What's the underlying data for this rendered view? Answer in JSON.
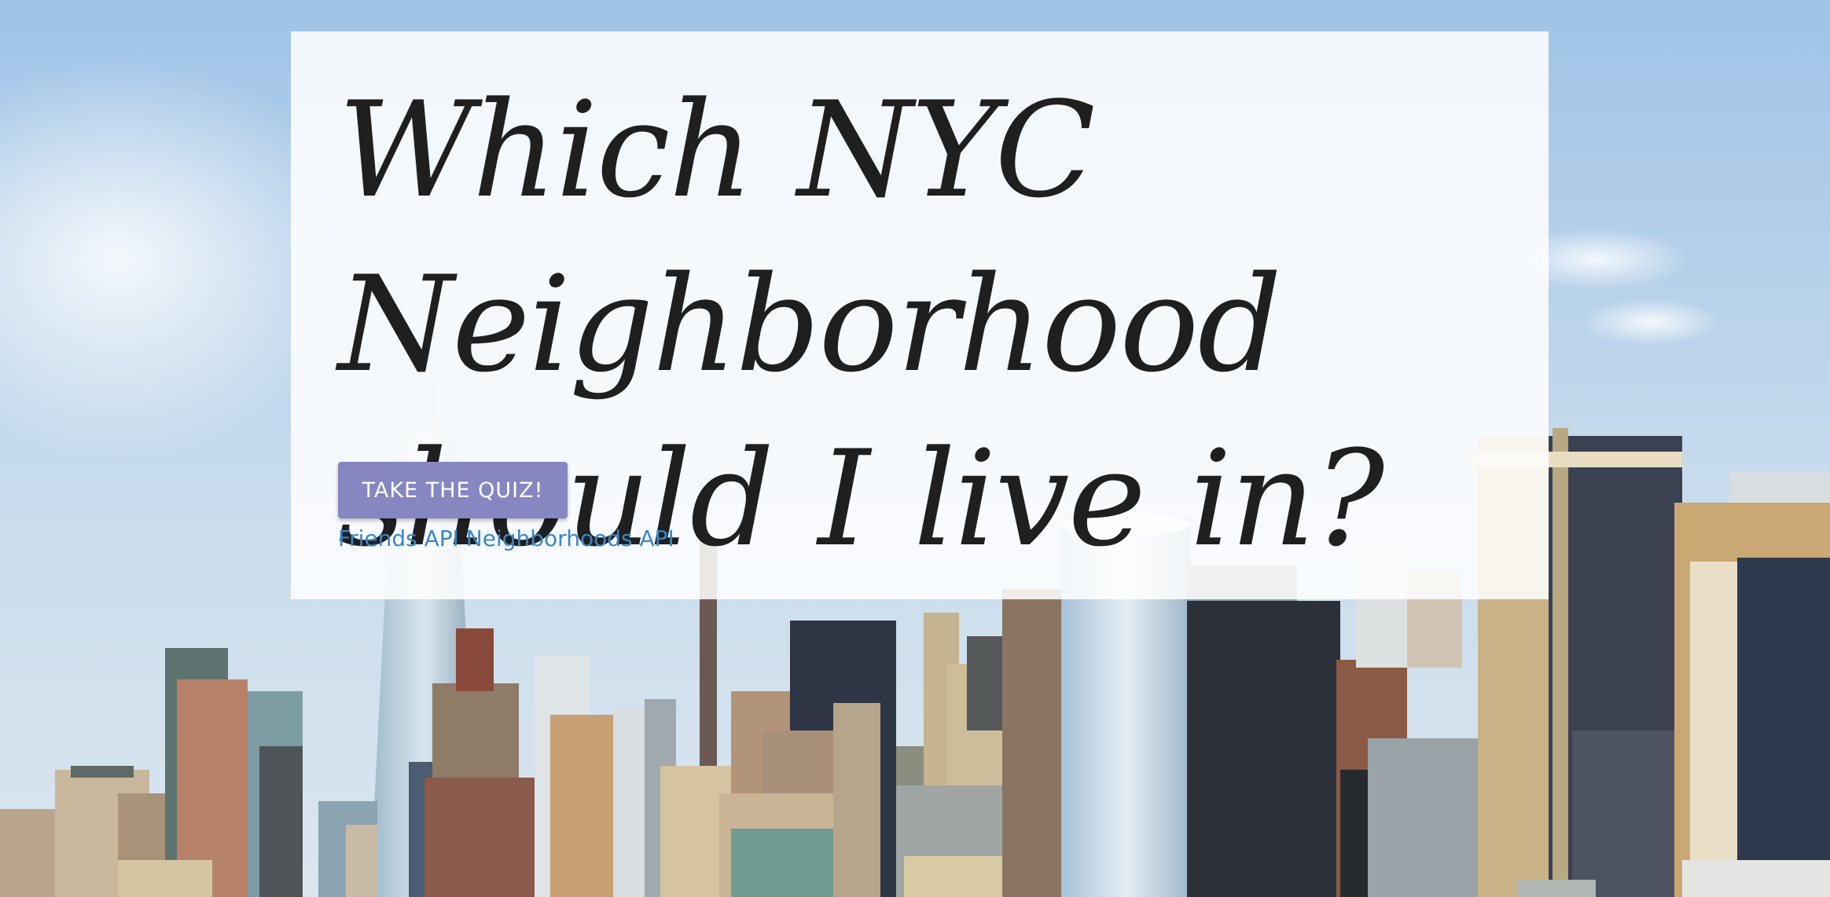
{
  "hero": {
    "title_line1": "Which NYC Neighborhood",
    "title_line2": "should I live in?",
    "cta_label": "TAKE THE QUIZ!",
    "links": [
      "Friends API",
      "Neighborhoods API"
    ]
  },
  "background": {
    "description_icon": "nyc-skyline-photo",
    "sky_color": "#a9c9e6"
  },
  "colors": {
    "button": "#8686c0",
    "link": "#3a86c8",
    "title": "#1f1f1f"
  }
}
